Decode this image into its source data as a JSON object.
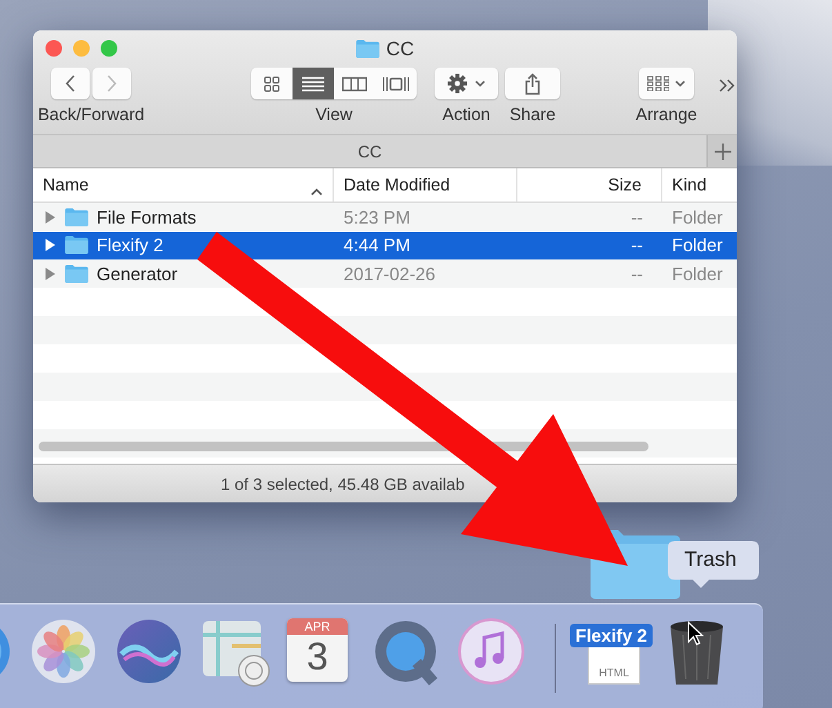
{
  "window": {
    "title": "CC",
    "toolbar": [
      {
        "kind": "nav",
        "label": "Back/Forward"
      },
      {
        "kind": "view",
        "label": "View",
        "segments": [
          {
            "kind": "icons",
            "selected": false
          },
          {
            "kind": "list",
            "selected": true
          },
          {
            "kind": "columns",
            "selected": false
          },
          {
            "kind": "gallery",
            "selected": false
          }
        ]
      },
      {
        "kind": "action",
        "label": "Action"
      },
      {
        "kind": "share",
        "label": "Share"
      },
      {
        "kind": "arrange",
        "label": "Arrange"
      }
    ],
    "tab_bar": {
      "title": "CC"
    },
    "columns": [
      {
        "label": "Name",
        "sorted": true
      },
      {
        "label": "Date Modified",
        "sorted": false
      },
      {
        "label": "Size",
        "sorted": false
      },
      {
        "label": "Kind",
        "sorted": false
      }
    ],
    "rows": [
      {
        "name": "File Formats",
        "date": "5:23 PM",
        "size": "--",
        "kind": "Folder",
        "selected": false,
        "expanded": false
      },
      {
        "name": "Flexify 2",
        "date": "4:44 PM",
        "size": "--",
        "kind": "Folder",
        "selected": true,
        "expanded": false
      },
      {
        "name": "Generator",
        "date": "2017-02-26",
        "size": "--",
        "kind": "Folder",
        "selected": false,
        "expanded": false
      }
    ],
    "status_bar": "1 of 3 selected, 45.48 GB availab"
  },
  "drag": {
    "tooltip": "Trash"
  },
  "dock": {
    "items": [
      {
        "kind": "app-edge"
      },
      {
        "kind": "photos"
      },
      {
        "kind": "siri"
      },
      {
        "kind": "maps"
      },
      {
        "kind": "calendar",
        "month": "APR",
        "day": "3"
      },
      {
        "kind": "quicktime"
      },
      {
        "kind": "music"
      },
      {
        "kind": "divider"
      },
      {
        "kind": "document",
        "badge": "Flexify 2",
        "type_label": "HTML"
      },
      {
        "kind": "trash"
      }
    ]
  }
}
